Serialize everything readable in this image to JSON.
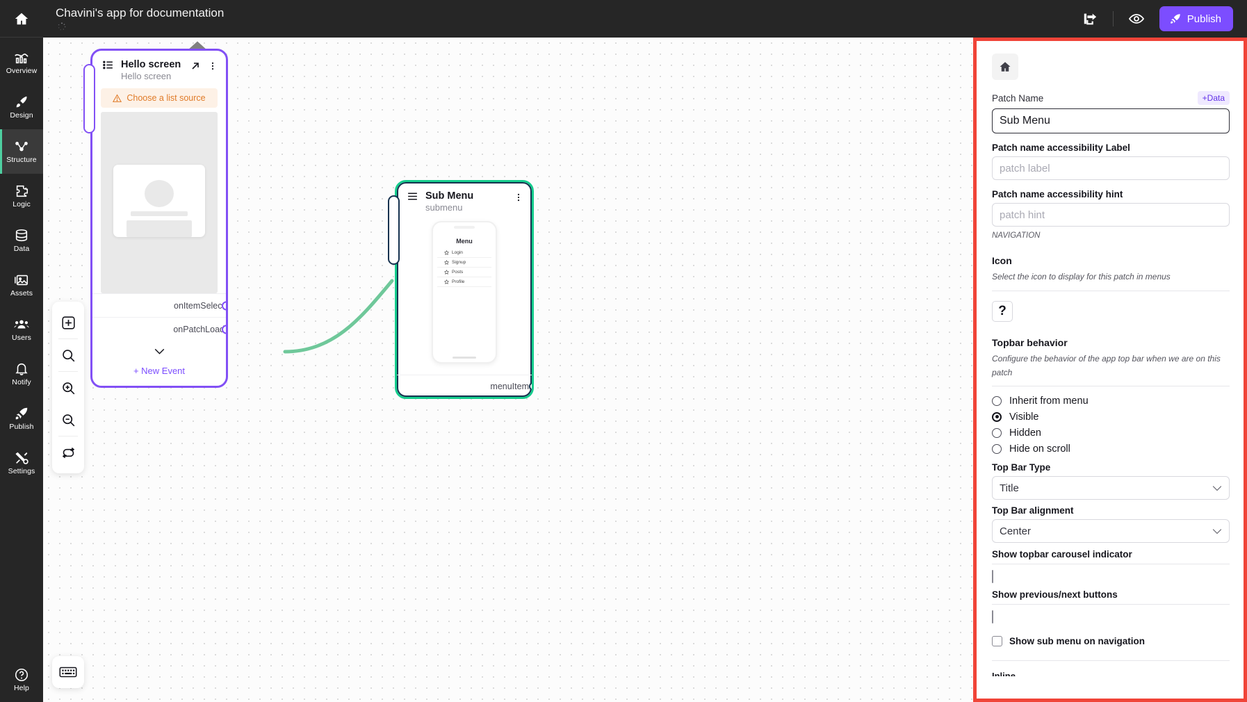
{
  "sidebar": {
    "home_icon": "home-icon",
    "items": [
      {
        "label": "Overview",
        "icon": "chart-icon"
      },
      {
        "label": "Design",
        "icon": "paint-brush-icon"
      },
      {
        "label": "Structure",
        "icon": "nodes-icon",
        "active": true
      },
      {
        "label": "Logic",
        "icon": "puzzle-icon"
      },
      {
        "label": "Data",
        "icon": "database-icon"
      },
      {
        "label": "Assets",
        "icon": "image-icon"
      },
      {
        "label": "Users",
        "icon": "users-icon"
      },
      {
        "label": "Notify",
        "icon": "bell-icon"
      },
      {
        "label": "Publish",
        "icon": "rocket-icon"
      },
      {
        "label": "Settings",
        "icon": "tools-icon"
      }
    ],
    "help": {
      "label": "Help",
      "icon": "question-circle-icon"
    }
  },
  "topbar": {
    "title": "Chavini's app for documentation",
    "spinner": "loading-spinner",
    "share_icon": "share-icon",
    "preview_icon": "eye-icon",
    "publish_label": "Publish",
    "publish_icon": "rocket-icon",
    "publish_color": "#7c4dff"
  },
  "canvas": {
    "tools": [
      {
        "name": "add-node-button",
        "icon": "plus-square-icon"
      },
      {
        "name": "search-button",
        "icon": "search-icon"
      },
      {
        "name": "zoom-in-button",
        "icon": "zoom-in-icon"
      },
      {
        "name": "zoom-out-button",
        "icon": "zoom-out-icon"
      },
      {
        "name": "refresh-button",
        "icon": "refresh-icon"
      }
    ],
    "keyboard_shortcut_button": {
      "name": "keyboard-button",
      "icon": "keyboard-icon"
    },
    "nodes": [
      {
        "id": "hello-screen",
        "title": "Hello screen",
        "subtitle": "Hello screen",
        "type_icon": "list-icon",
        "open_icon": "arrow-up-right-icon",
        "menu_icon": "kebab-menu-icon",
        "home_badge_icon": "home-icon",
        "warning": "Choose a list source",
        "warning_icon": "warning-triangle-icon",
        "accent_color": "#8250f5",
        "events": [
          "onItemSelect",
          "onPatchLoad"
        ],
        "collapse_icon": "chevron-down-icon",
        "new_event_label": "+ New Event"
      },
      {
        "id": "sub-menu",
        "title": "Sub Menu",
        "subtitle": "submenu",
        "type_icon": "hamburger-icon",
        "menu_icon": "kebab-menu-icon",
        "accent_color": "#14cc8c",
        "outline_color": "#16324f",
        "events": [
          "menuItem"
        ],
        "preview": {
          "menu_title": "Menu",
          "items": [
            {
              "label": "Login",
              "icon": "star-icon"
            },
            {
              "label": "Signup",
              "icon": "star-icon"
            },
            {
              "label": "Posts",
              "icon": "star-icon"
            },
            {
              "label": "Profile",
              "icon": "star-icon"
            }
          ]
        }
      }
    ],
    "connection_color": "#6fc89a"
  },
  "right_panel": {
    "highlight_color": "#f04438",
    "patch_icon": "home-icon",
    "patch_name_label": "Patch Name",
    "data_chip_label": "+Data",
    "patch_name_value": "Sub Menu",
    "accessibility_label_title": "Patch name accessibility Label",
    "accessibility_label_placeholder": "patch label",
    "accessibility_label_value": "",
    "accessibility_hint_title": "Patch name accessibility hint",
    "accessibility_hint_placeholder": "patch hint",
    "accessibility_hint_value": "",
    "navigation_caption": "NAVIGATION",
    "icon_section_title": "Icon",
    "icon_section_desc": "Select the icon to display for this patch in menus",
    "icon_picker_glyph": "?",
    "topbar_section_title": "Topbar behavior",
    "topbar_section_desc": "Configure the behavior of the app top bar when we are on this patch",
    "topbar_options": [
      {
        "label": "Inherit from menu",
        "selected": false
      },
      {
        "label": "Visible",
        "selected": true
      },
      {
        "label": "Hidden",
        "selected": false
      },
      {
        "label": "Hide on scroll",
        "selected": false
      }
    ],
    "top_bar_type_label": "Top Bar Type",
    "top_bar_type_value": "Title",
    "top_bar_alignment_label": "Top Bar alignment",
    "top_bar_alignment_value": "Center",
    "carousel_indicator_label": "Show topbar carousel indicator",
    "carousel_indicator_checked": false,
    "prev_next_label": "Show previous/next buttons",
    "prev_next_checked": false,
    "sub_menu_nav_label": "Show sub menu on navigation",
    "sub_menu_nav_checked": false,
    "cut_off_label": "Inline"
  }
}
